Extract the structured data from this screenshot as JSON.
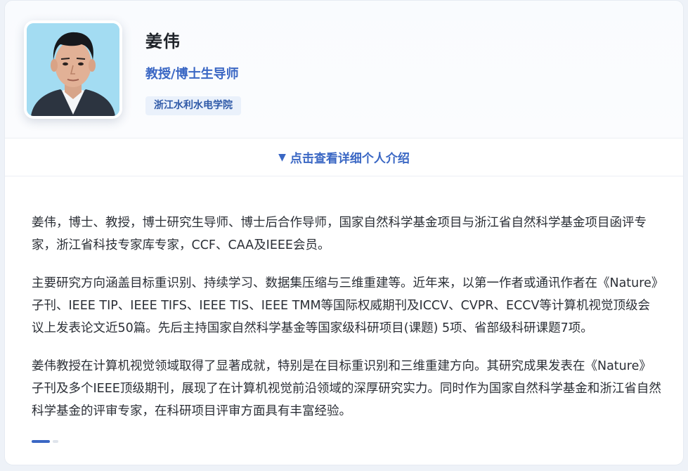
{
  "profile": {
    "name": "姜伟",
    "title": "教授/博士生导师",
    "affiliation": "浙江水利水电学院",
    "avatar_icon": "person-portrait-icon"
  },
  "toggle": {
    "arrow": "▼",
    "label": "点击查看详细个人介绍"
  },
  "bio": {
    "paragraphs": [
      "姜伟，博士、教授，博士研究生导师、博士后合作导师，国家自然科学基金项目与浙江省自然科学基金项目函评专家，浙江省科技专家库专家，CCF、CAA及IEEE会员。",
      "主要研究方向涵盖目标重识别、持续学习、数据集压缩与三维重建等。近年来，以第一作者或通讯作者在《Nature》子刊、IEEE TIP、IEEE TIFS、IEEE TIS、IEEE TMM等国际权威期刊及ICCV、CVPR、ECCV等计算机视觉顶级会议上发表论文近50篇。先后主持国家自然科学基金等国家级科研项目(课题) 5项、省部级科研课题7项。",
      "姜伟教授在计算机视觉领域取得了显著成就，特别是在目标重识别和三维重建方向。其研究成果发表在《Nature》子刊及多个IEEE顶级期刊，展现了在计算机视觉前沿领域的深厚研究实力。同时作为国家自然科学基金和浙江省自然科学基金的评审专家，在科研项目评审方面具有丰富经验。"
    ]
  },
  "colors": {
    "accent": "#3a67c4",
    "badge_bg": "#eaf1fb",
    "avatar_bg": "#9fd9f0"
  }
}
